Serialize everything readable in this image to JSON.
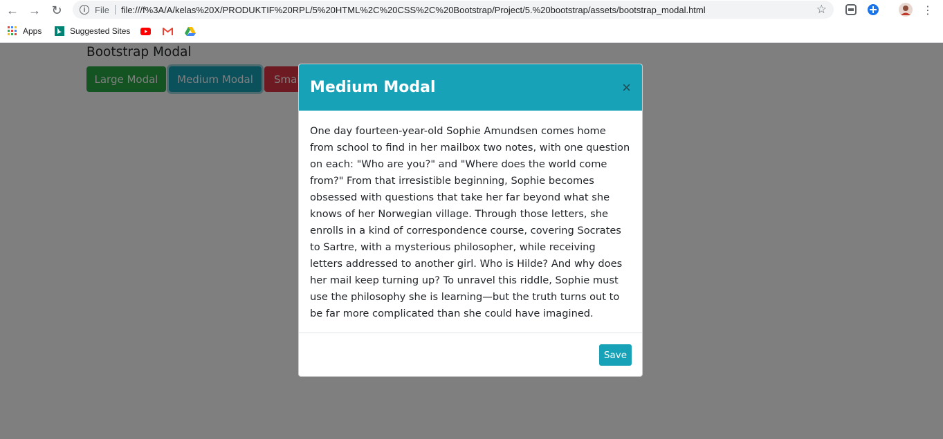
{
  "browser": {
    "file_label": "File",
    "url": "file:///f%3A/A/kelas%20X/PRODUKTIF%20RPL/5%20HTML%2C%20CSS%2C%20Bootstrap/Project/5.%20bootstrap/assets/bootstrap_modal.html",
    "bookmarks": [
      {
        "label": "Apps"
      },
      {
        "label": "Suggested Sites"
      }
    ]
  },
  "page": {
    "title": "Bootstrap Modal",
    "buttons": [
      {
        "label": "Large Modal",
        "color": "#28a745"
      },
      {
        "label": "Medium Modal",
        "color": "#17a2b8"
      },
      {
        "label": "Small Modal",
        "color": "#dc3545"
      }
    ]
  },
  "modal": {
    "title": "Medium Modal",
    "close_glyph": "×",
    "header_color": "#17a2b8",
    "body": "One day fourteen-year-old Sophie Amundsen comes home from school to find in her mailbox two notes, with one question on each: \"Who are you?\" and \"Where does the world come from?\" From that irresistible beginning, Sophie becomes obsessed with questions that take her far beyond what she knows of her Norwegian village. Through those letters, she enrolls in a kind of correspondence course, covering Socrates to Sartre, with a mysterious philosopher, while receiving letters addressed to another girl. Who is Hilde? And why does her mail keep turning up? To unravel this riddle, Sophie must use the philosophy she is learning—but the truth turns out to be far more complicated than she could have imagined.",
    "save_label": "Save"
  }
}
